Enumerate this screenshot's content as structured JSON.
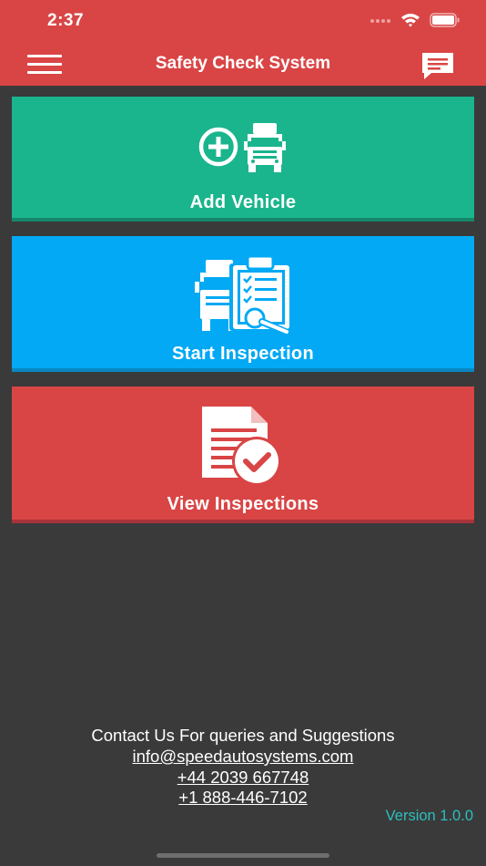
{
  "status_bar": {
    "time": "2:37"
  },
  "header": {
    "title": "Safety Check System"
  },
  "tiles": {
    "add_vehicle": "Add Vehicle",
    "start_inspection": "Start Inspection",
    "view_inspections": "View Inspections"
  },
  "footer": {
    "contact": "Contact Us For queries and Suggestions",
    "email": "info@speedautosystems.com",
    "phone_uk": "+44 2039 667748",
    "phone_us": "+1 888-446-7102",
    "version": "Version 1.0.0"
  },
  "colors": {
    "header": "#d94545",
    "background": "#3a3a3a",
    "add_tile": "#1ab58d",
    "start_tile": "#03a9f4",
    "view_tile": "#d94545",
    "version_text": "#2bbfbf"
  },
  "icons": {
    "menu": "hamburger-menu-icon",
    "chat": "chat-message-icon",
    "add_vehicle": "plus-truck-icon",
    "start_inspection": "truck-checklist-magnifier-icon",
    "view_inspections": "document-check-icon"
  }
}
